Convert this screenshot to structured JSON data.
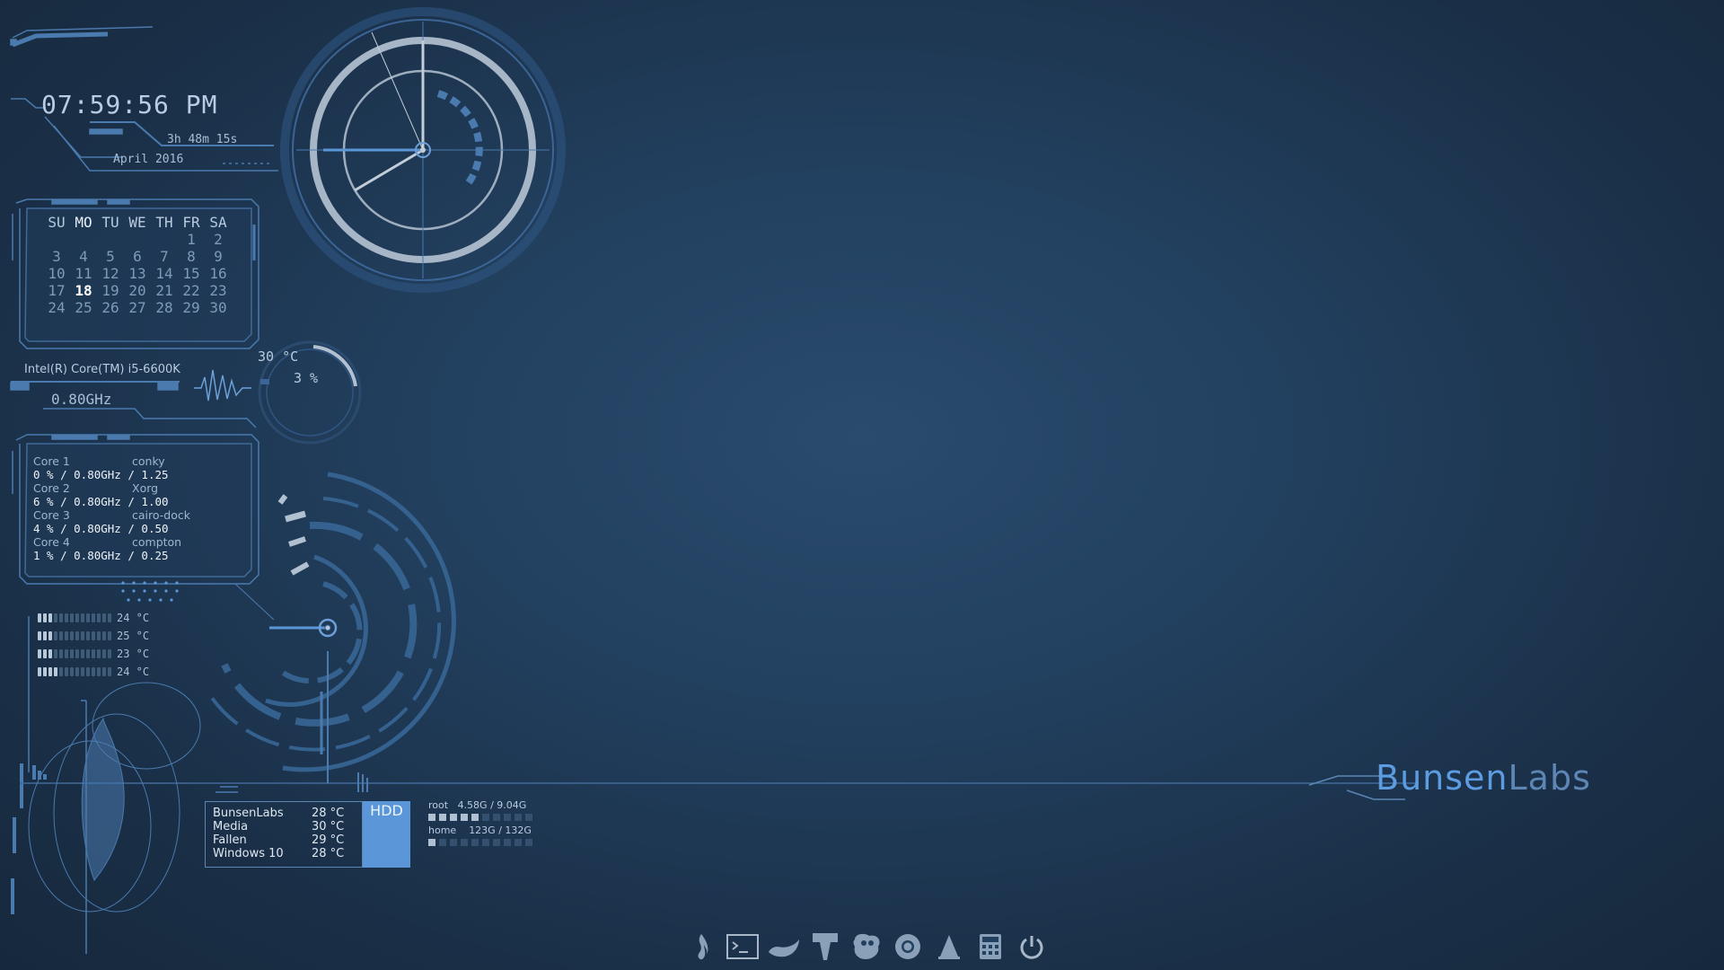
{
  "clock": {
    "time": "07:59:56 PM",
    "uptime": "3h 48m 15s",
    "month_year": "April 2016"
  },
  "calendar": {
    "day_headers": [
      "SU",
      "MO",
      "TU",
      "WE",
      "TH",
      "FR",
      "SA"
    ],
    "weeks": [
      [
        "",
        "",
        "",
        "",
        "",
        "1",
        "2"
      ],
      [
        "3",
        "4",
        "5",
        "6",
        "7",
        "8",
        "9"
      ],
      [
        "10",
        "11",
        "12",
        "13",
        "14",
        "15",
        "16"
      ],
      [
        "17",
        "18",
        "19",
        "20",
        "21",
        "22",
        "23"
      ],
      [
        "24",
        "25",
        "26",
        "27",
        "28",
        "29",
        "30"
      ]
    ],
    "today": "18"
  },
  "cpu": {
    "name": "Intel(R) Core(TM) i5-6600K",
    "frequency": "0.80GHz",
    "temperature": "30 °C",
    "load": "3 %",
    "load_percent": 3,
    "cores": [
      {
        "label": "Core 1",
        "value": "0 % / 0.80GHz",
        "process": "conky",
        "process_value": "/ 1.25"
      },
      {
        "label": "Core 2",
        "value": "6 % / 0.80GHz",
        "process": "Xorg",
        "process_value": "/ 1.00"
      },
      {
        "label": "Core 3",
        "value": "4 % / 0.80GHz",
        "process": "cairo-dock",
        "process_value": "/ 0.50"
      },
      {
        "label": "Core 4",
        "value": "1 % / 0.80GHz",
        "process": "compton",
        "process_value": "/ 0.25"
      }
    ]
  },
  "core_temps": [
    {
      "value": "24 °C",
      "level": 3
    },
    {
      "value": "25 °C",
      "level": 3
    },
    {
      "value": "23 °C",
      "level": 3
    },
    {
      "value": "24 °C",
      "level": 4
    }
  ],
  "drives": {
    "tag": "HDD",
    "list": [
      {
        "name": "BunsenLabs",
        "temp": "28 °C"
      },
      {
        "name": "Media",
        "temp": "30 °C"
      },
      {
        "name": "Fallen",
        "temp": "29 °C"
      },
      {
        "name": "Windows 10",
        "temp": "28 °C"
      }
    ]
  },
  "disks": [
    {
      "label": "root",
      "usage": "4.58G / 9.04G",
      "filled": 5,
      "total": 10
    },
    {
      "label": "home",
      "usage": "123G / 132G",
      "filled": 1,
      "total": 10
    }
  ],
  "brand": {
    "part1": "Bunsen",
    "part2": "Labs"
  },
  "dock": [
    "flame-icon",
    "terminal-icon",
    "file-manager-icon",
    "text-editor-icon",
    "gimp-icon",
    "chrome-icon",
    "vlc-icon",
    "calculator-icon",
    "power-icon"
  ],
  "colors": {
    "accent": "#5b97d8",
    "line": "#4a7aae",
    "text": "#a8bfd6"
  }
}
